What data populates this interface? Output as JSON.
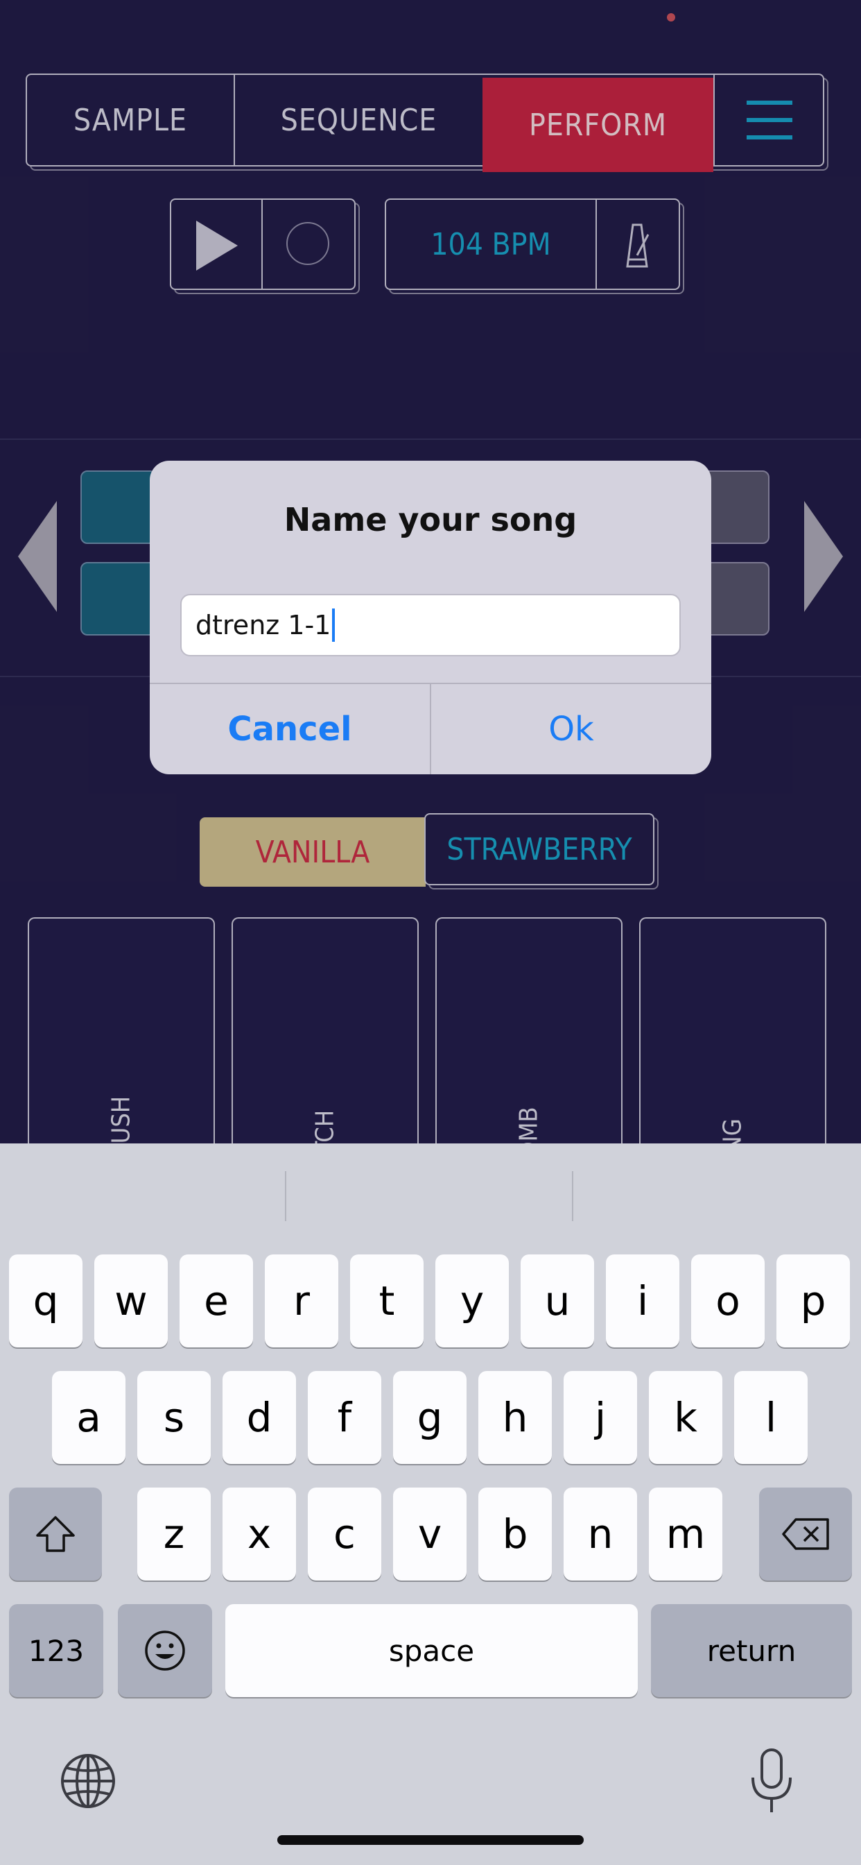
{
  "header": {
    "tabs": [
      {
        "label": "SAMPLE"
      },
      {
        "label": "SEQUENCE"
      },
      {
        "label": "PERFORM"
      }
    ],
    "active_tab": "PERFORM"
  },
  "transport": {
    "bpm_label": "104 BPM"
  },
  "flavors": {
    "vanilla": "VANILLA",
    "strawberry": "STRAWBERRY",
    "selected": "VANILLA"
  },
  "effects": [
    {
      "label": "CRUSH"
    },
    {
      "label": "PITCH"
    },
    {
      "label": "COMB"
    },
    {
      "label": "RING"
    }
  ],
  "dialog": {
    "title": "Name your song",
    "input_value": "dtrenz 1-1",
    "cancel_label": "Cancel",
    "ok_label": "Ok"
  },
  "keyboard": {
    "row1": [
      "q",
      "w",
      "e",
      "r",
      "t",
      "y",
      "u",
      "i",
      "o",
      "p"
    ],
    "row2": [
      "a",
      "s",
      "d",
      "f",
      "g",
      "h",
      "j",
      "k",
      "l"
    ],
    "row3": [
      "z",
      "x",
      "c",
      "v",
      "b",
      "n",
      "m"
    ],
    "numbers_label": "123",
    "space_label": "space",
    "return_label": "return"
  },
  "colors": {
    "background": "#221c47",
    "perform_active": "#c32443",
    "accent_blue": "#1aa2c8",
    "vanilla_bg": "#cdbd8f",
    "ios_blue": "#1a7cf5"
  }
}
